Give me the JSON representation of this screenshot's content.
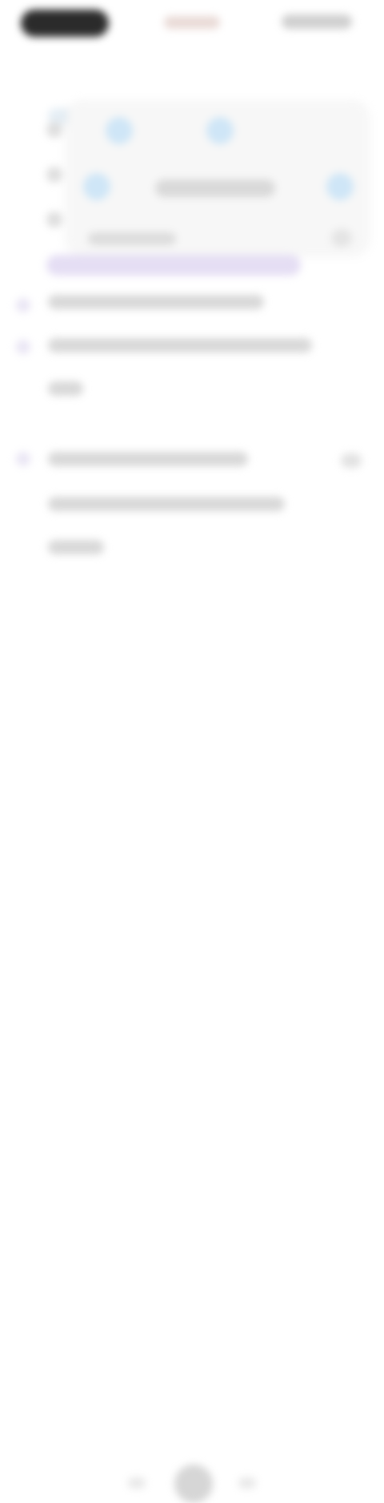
{
  "screen": {
    "status": {
      "time": "",
      "center": "",
      "right": ""
    },
    "toolbar": {
      "tabs": [
        "",
        "",
        ""
      ]
    },
    "card": {
      "title": "",
      "subtitle": ""
    },
    "content": {
      "paragraph_1": "",
      "paragraph_2": ""
    }
  },
  "colors": {
    "status_pill": "#2b2b2b",
    "active_tab": "#bfe0f4",
    "accent_purple": "#e5def4",
    "card_bg": "#f7f7f7"
  },
  "icons": [
    "chevron-icon",
    "info-icon",
    "plus-icon",
    "home-icon"
  ]
}
